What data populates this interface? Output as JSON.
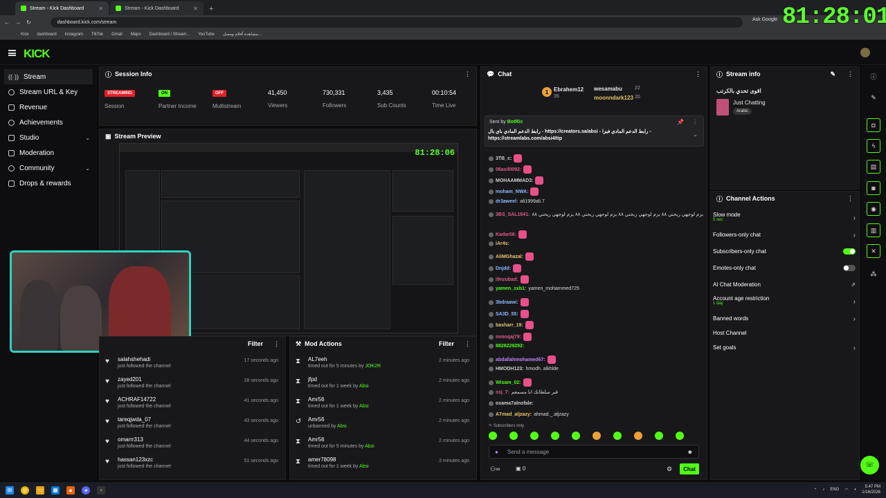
{
  "browser": {
    "tabs": [
      {
        "label": "Stream - Kick Dashboard"
      },
      {
        "label": "Stream - Kick Dashboard"
      }
    ],
    "url": "dashboard.kick.com/stream",
    "ask_google": "Ask Google",
    "bookmarks": [
      "Kick",
      "dashboard",
      "instagram",
      "TikTok",
      "Gmail",
      "Maps",
      "Dashboard / Stream...",
      "YouTube",
      "مشاهدة أفلام ومسل..."
    ]
  },
  "overlay_clock": "81:28:01",
  "logo": "KICK",
  "sidebar": {
    "items": [
      {
        "label": "Stream"
      },
      {
        "label": "Stream URL & Key"
      },
      {
        "label": "Revenue"
      },
      {
        "label": "Achievements"
      },
      {
        "label": "Studio"
      },
      {
        "label": "Moderation"
      },
      {
        "label": "Community"
      },
      {
        "label": "Drops & rewards"
      }
    ]
  },
  "session": {
    "title": "Session Info",
    "stats": [
      {
        "badge": "STREAMING",
        "label": "Session"
      },
      {
        "badge": "ON",
        "label": "Partner Income"
      },
      {
        "badge": "OFF",
        "label": "Multistream"
      },
      {
        "value": "41,450",
        "label": "Viewers"
      },
      {
        "value": "730,331",
        "label": "Followers"
      },
      {
        "value": "3,435",
        "label": "Sub Counts"
      },
      {
        "value": "00:10:54",
        "label": "Time Live"
      }
    ]
  },
  "preview": {
    "title": "Stream Preview",
    "clock": "81:28:06"
  },
  "follows": {
    "filter": "Filter",
    "rows": [
      {
        "name": "salahshehadi",
        "status": "just followed the channel",
        "time": "17 seconds ago"
      },
      {
        "name": "zayed201",
        "status": "just followed the channel",
        "time": "28 seconds ago"
      },
      {
        "name": "ACHRAF14722",
        "status": "just followed the channel",
        "time": "41 seconds ago"
      },
      {
        "name": "tareqjwda_07",
        "status": "just followed the channel",
        "time": "43 seconds ago"
      },
      {
        "name": "omarrr313",
        "status": "just followed the channel",
        "time": "44 seconds ago"
      },
      {
        "name": "hassan123xzc",
        "status": "just followed the channel",
        "time": "51 seconds ago"
      }
    ]
  },
  "mod_actions": {
    "title": "Mod Actions",
    "filter": "Filter",
    "rows": [
      {
        "name": "AL7eeh",
        "action": "timed out for 5 minutes by ",
        "by": "JOK2R",
        "time": "2 minutes ago"
      },
      {
        "name": "jfpd",
        "action": "timed out for 1 week by ",
        "by": "Absi",
        "time": "2 minutes ago"
      },
      {
        "name": "Amr56",
        "action": "timed out for 1 week by ",
        "by": "Absi",
        "time": "2 minutes ago"
      },
      {
        "name": "Amr56",
        "action": "unbanned by ",
        "by": "Absi",
        "time": "2 minutes ago"
      },
      {
        "name": "Amr56",
        "action": "timed out for 5 minutes by ",
        "by": "Absi",
        "time": "2 minutes ago"
      },
      {
        "name": "amer78098",
        "action": "timed out for 1 week by ",
        "by": "Absi",
        "time": "3 minutes ago"
      }
    ]
  },
  "chat": {
    "title": "Chat",
    "leaders": [
      {
        "rank": "1",
        "name": "Ebrahem12",
        "count": "35"
      },
      {
        "name": "wesamabu",
        "count": "22"
      },
      {
        "name": "moonndark123",
        "count": "20"
      }
    ],
    "pinned": {
      "sent_by": "Sent by",
      "bot": "BotRix",
      "text": "رابط الدعم المادي باي بال - https://creators.sa/absi - رابط الدعم المادي فيزا - https://streamlabs.com/absi4/tip"
    },
    "messages": [
      {
        "user": "3TB_c:",
        "text": "",
        "color": "#cfcfcf",
        "emote": true
      },
      {
        "user": "06asil0092:",
        "text": "",
        "color": "#e05a8a",
        "emote": true
      },
      {
        "user": "MOHAAMMAD3:",
        "text": "",
        "color": "#cfcfcf",
        "emote": true
      },
      {
        "user": "moham_NWA:",
        "text": "",
        "color": "#8fb8ff",
        "emote": true
      },
      {
        "user": "dr3aweel:",
        "text": "ali1999ali.7",
        "color": "#8fb8ff",
        "emote": false
      },
      {
        "user": "3BS_SAL1641:",
        "text": "يزم لوجهي ريحني ٨٨ يزم لوجهي ريحني ٨٨ يزم لوجهي ريحني ٨٨ يزم لوجهي ريحني ٨٨",
        "color": "#e05a8a",
        "emote": false
      },
      {
        "user": "Kadar06:",
        "text": "",
        "color": "#e05a8a",
        "emote": true
      },
      {
        "user": "iAr4s:",
        "text": "",
        "color": "#e9c46a",
        "emote": false
      },
      {
        "user": "AliMGhazal:",
        "text": "",
        "color": "#e9c46a",
        "emote": true
      },
      {
        "user": "Dnjdd:",
        "text": "",
        "color": "#8fb8ff",
        "emote": true
      },
      {
        "user": "i9nzubad:",
        "text": "",
        "color": "#e05a8a",
        "emote": true
      },
      {
        "user": "yamen_sxb1:",
        "text": "yamen_mohammed725",
        "color": "#53fc18",
        "emote": false
      },
      {
        "user": "3bdraawi:",
        "text": "",
        "color": "#8fb8ff",
        "emote": true
      },
      {
        "user": "SA3D_55:",
        "text": "",
        "color": "#8fb8ff",
        "emote": true
      },
      {
        "user": "basharr_19:",
        "text": "",
        "color": "#e9c46a",
        "emote": true
      },
      {
        "user": "mmoqaj79:",
        "text": "",
        "color": "#e05a8a",
        "emote": true
      },
      {
        "user": "8828229292:",
        "text": "",
        "color": "#53fc18",
        "emote": false
      },
      {
        "user": "abdallahmohamed67:",
        "text": "",
        "color": "#c084fc",
        "emote": true
      },
      {
        "user": "HMODH123:",
        "text": "hmodh. alkhlde",
        "color": "#cfcfcf",
        "emote": false
      },
      {
        "user": "Wisam_02:",
        "text": "",
        "color": "#53fc18",
        "emote": true
      },
      {
        "user": "ssj_7:",
        "text": "قبر سلطانك انا مسمعم",
        "color": "#e05a8a",
        "emote": false
      },
      {
        "user": "osama7alnofale:",
        "text": "",
        "color": "#cfcfcf",
        "emote": false
      },
      {
        "user": "A7mad_aljzazy:",
        "text": "ahmad._.aljzazy",
        "color": "#e9c46a",
        "emote": false
      }
    ],
    "mode_label": "Subscribers only",
    "placeholder": "Send a message",
    "count": "0",
    "send": "Chat"
  },
  "stream_info": {
    "title": "Stream info",
    "stream_title": "اقوى تحدي بالكرتب",
    "category": "Just Chatting",
    "tag": "Arabic"
  },
  "channel_actions": {
    "title": "Channel Actions",
    "rows": [
      {
        "label": "Slow mode",
        "sub": "5 sec",
        "kind": "arrow"
      },
      {
        "label": "Followers-only chat",
        "sub": "",
        "kind": "arrow"
      },
      {
        "label": "Subscribers-only chat",
        "sub": "",
        "kind": "toggle-on"
      },
      {
        "label": "Emotes-only chat",
        "sub": "",
        "kind": "toggle-off"
      },
      {
        "label": "AI Chat Moderation",
        "sub": "",
        "kind": "ext"
      },
      {
        "label": "Account age restriction",
        "sub": "1 day",
        "kind": "arrow"
      },
      {
        "label": "Banned words",
        "sub": "",
        "kind": "arrow"
      },
      {
        "label": "Host Channel",
        "sub": "",
        "kind": "none"
      },
      {
        "label": "Set goals",
        "sub": "",
        "kind": "arrow"
      }
    ]
  },
  "taskbar": {
    "lang": "ENG",
    "time": "5:47 PM",
    "date": "1/16/2026"
  },
  "colors": {
    "accent": "#53fc18",
    "streaming": "#e0212b",
    "on": "#53fc18",
    "off": "#e0212b"
  }
}
